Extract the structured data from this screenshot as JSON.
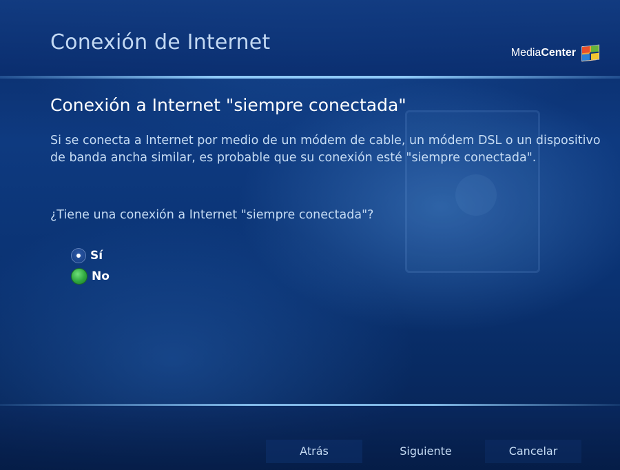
{
  "header": {
    "title": "Conexión de Internet",
    "brand_light": "Media",
    "brand_bold": "Center",
    "brand_icon": "windows-flag-icon"
  },
  "main": {
    "section_title": "Conexión a Internet \"siempre conectada\"",
    "description": "Si se conecta a Internet por medio de un módem de cable, un módem DSL o un dispositivo de banda ancha similar, es probable que su conexión esté \"siempre conectada\".",
    "question": "¿Tiene una conexión a Internet \"siempre conectada\"?",
    "options": [
      {
        "label": "Sí",
        "selected": true,
        "focused": false
      },
      {
        "label": "No",
        "selected": false,
        "focused": true
      }
    ]
  },
  "footer": {
    "back_label": "Atrás",
    "next_label": "Siguiente",
    "cancel_label": "Cancelar"
  },
  "colors": {
    "background": "#0a3272",
    "accent_line": "#96d2ff",
    "focus_green": "#2fa63f",
    "text_light": "#c6dcf4"
  }
}
